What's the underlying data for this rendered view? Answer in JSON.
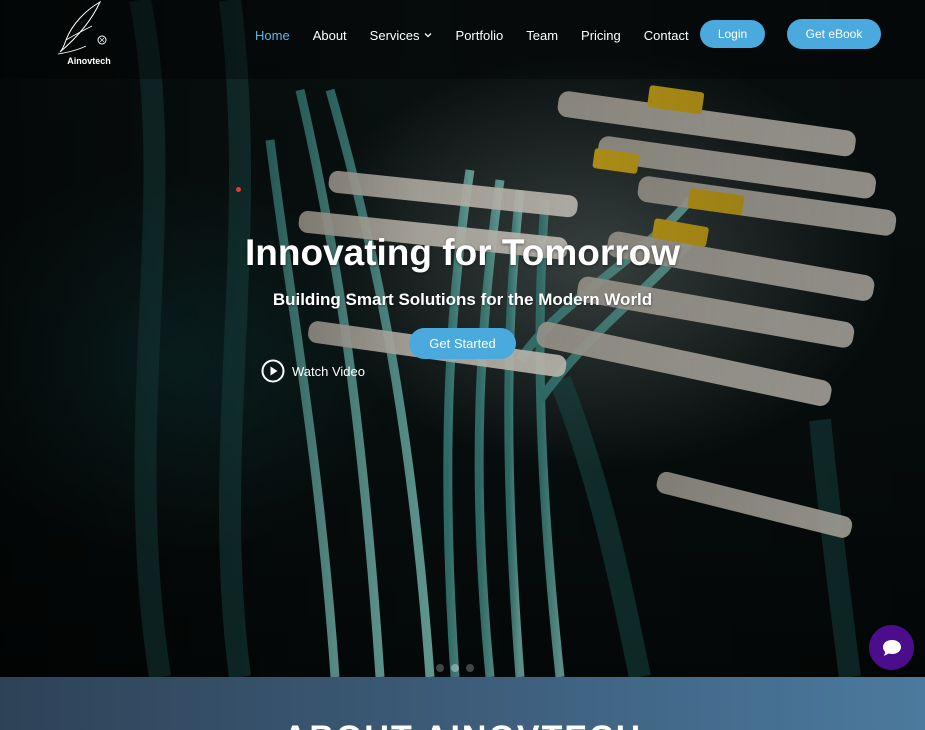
{
  "brand": {
    "name": "Ainovtech"
  },
  "nav": {
    "items": [
      {
        "label": "Home",
        "active": true
      },
      {
        "label": "About"
      },
      {
        "label": "Services",
        "has_dropdown": true
      },
      {
        "label": "Portfolio"
      },
      {
        "label": "Team"
      },
      {
        "label": "Pricing"
      },
      {
        "label": "Contact"
      }
    ],
    "login_label": "Login",
    "ebook_label": "Get eBook"
  },
  "hero": {
    "title": "Innovating for Tomorrow",
    "subtitle": "Building Smart Solutions for the Modern World",
    "cta_label": "Get Started",
    "video_label": "Watch Video"
  },
  "next_section": {
    "title": "ABOUT AINOVTECH"
  },
  "colors": {
    "accent": "#4aa9dd",
    "nav_active": "#5bb6e6",
    "chat_bubble": "#4b0d8c",
    "band_start": "#2e4257",
    "band_end": "#4b7a9e"
  },
  "icons": {
    "logo": "leaf-logo-icon",
    "dropdown": "chevron-down-icon",
    "play": "play-circle-icon",
    "chat": "chat-bubble-icon"
  }
}
